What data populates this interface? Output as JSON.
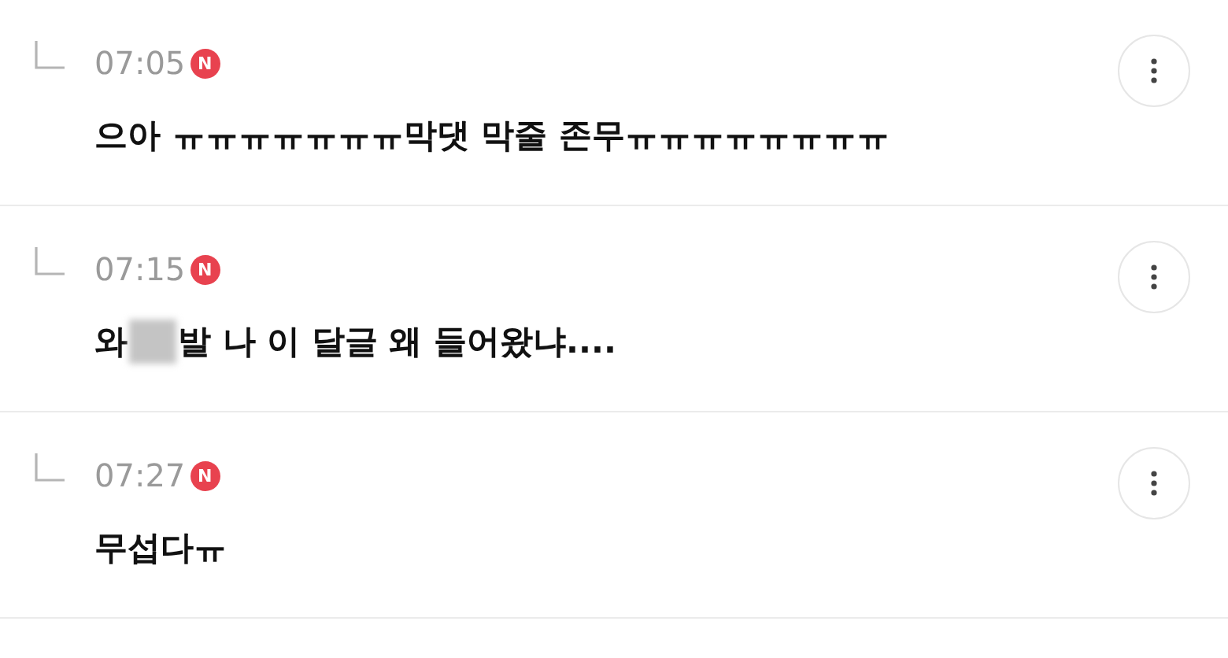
{
  "comments": [
    {
      "time": "07:05",
      "is_new": true,
      "badge": "N",
      "text_before": "으아 ㅠㅠㅠㅠㅠㅠㅠ막댓 막줄 존무ㅠㅠㅠㅠㅠㅠㅠㅠ",
      "censored": false
    },
    {
      "time": "07:15",
      "is_new": true,
      "badge": "N",
      "text_before": "와",
      "censored": true,
      "text_after": "발 나 이 달글 왜 들어왔냐...."
    },
    {
      "time": "07:27",
      "is_new": true,
      "badge": "N",
      "text_before": "무섭다ㅠ",
      "censored": false
    }
  ]
}
